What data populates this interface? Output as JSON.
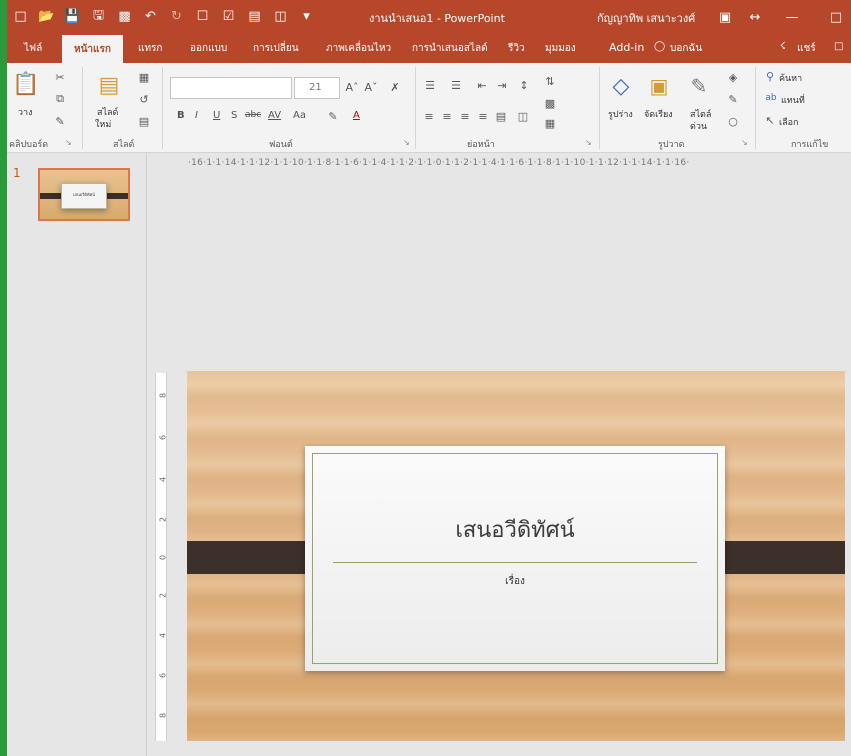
{
  "window": {
    "title": "งานนำเสนอ1 - PowerPoint",
    "user": "กัญญาทิพ เสนาะวงศ์",
    "accent": "#b7472a"
  },
  "qat": [
    "new-icon",
    "open-icon",
    "save-icon",
    "save-as-icon",
    "folder-icon",
    "undo-icon",
    "redo-icon",
    "slideshow-icon",
    "checkbox-icon",
    "layout-icon",
    "preview-icon",
    "customize-icon"
  ],
  "tabs": [
    "ไฟล์",
    "หน้าแรก",
    "แทรก",
    "ออกแบบ",
    "การเปลี่ยน",
    "ภาพเคลื่อนไหว",
    "การนำเสนอสไลด์",
    "รีวิว",
    "มุมมอง",
    "Add-in",
    "บอกฉัน",
    "แชร์"
  ],
  "ribbon": {
    "clipboard": {
      "paste": "วาง",
      "group": "คลิปบอร์ด"
    },
    "slides": {
      "new_slide_line1": "สไลด์",
      "new_slide_line2": "ใหม่",
      "group": "สไลด์"
    },
    "font": {
      "size": "21",
      "group": "ฟอนต์",
      "buttons": [
        "B",
        "I",
        "U",
        "S",
        "abc",
        "AV",
        "Aa",
        "A"
      ]
    },
    "paragraph": {
      "group": "ย่อหน้า"
    },
    "drawing": {
      "shapes": "รูปร่าง",
      "arrange": "จัดเรียง",
      "quick_styles_line1": "สไตล์",
      "quick_styles_line2": "ด่วน",
      "group": "รูปวาด"
    },
    "editing": {
      "find": "ค้นหา",
      "replace": "แทนที่",
      "select": "เลือก",
      "group": "การแก้ไข"
    }
  },
  "ruler": {
    "horizontal": "·16·1·1·14·1·1·12·1·1·10·1·1·8·1·1·6·1·1·4·1·1·2·1·1·0·1·1·2·1·1·4·1·1·6·1·1·8·1·1·10·1·1·12·1·1·14·1·1·16·",
    "vertical": [
      "8",
      "6",
      "4",
      "2",
      "0",
      "2",
      "4",
      "6",
      "8"
    ]
  },
  "slides_pane": {
    "slide_number": "1",
    "thumb_title": "เสนอวีดิทัศน์"
  },
  "slide": {
    "title": "เสนอวีดิทัศน์",
    "subtitle": "เรื่อง"
  }
}
